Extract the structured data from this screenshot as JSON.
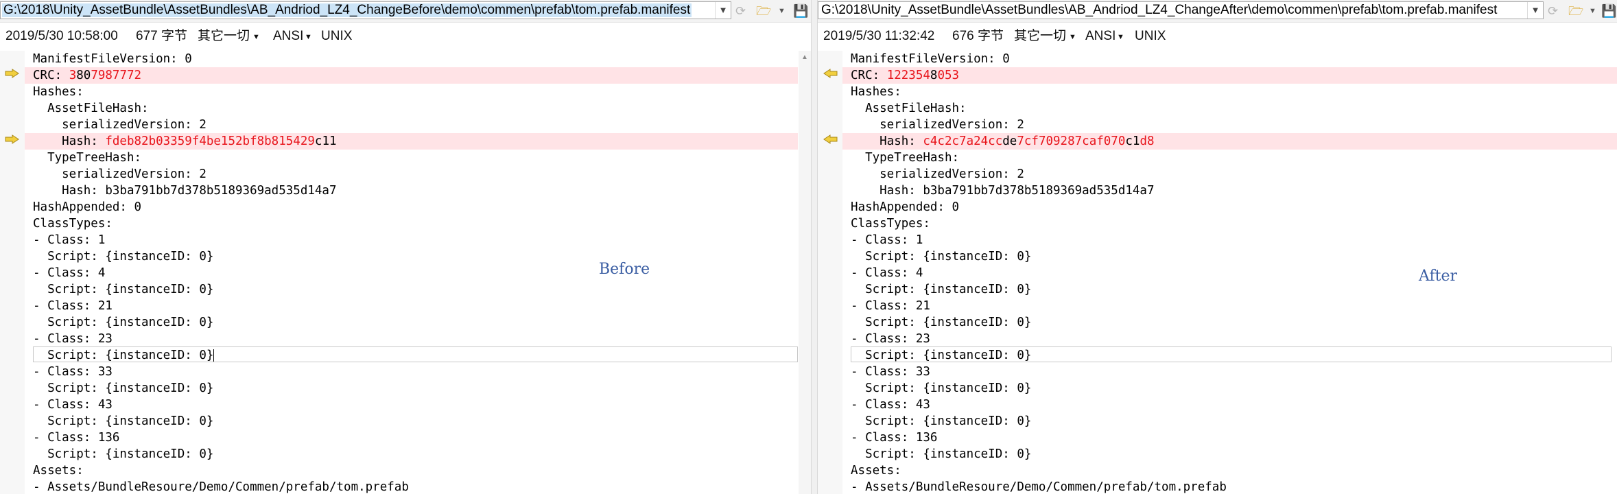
{
  "left": {
    "path": "G:\\2018\\Unity_AssetBundle\\AssetBundles\\AB_Andriod_LZ4_ChangeBefore\\demo\\commen\\prefab\\tom.prefab.manifest",
    "date": "2019/5/30 10:58:00",
    "size": "677 字节",
    "other": "其它一切",
    "encoding": "ANSI",
    "eol": "UNIX",
    "watermark": "Before",
    "crc_a": "3",
    "crc_b": "80",
    "crc_c": "7987772",
    "hash_a": "fde",
    "hash_b": "b82b03359f4be152bf8b815429",
    "hash_c": "c11"
  },
  "right": {
    "path": "G:\\2018\\Unity_AssetBundle\\AssetBundles\\AB_Andriod_LZ4_ChangeAfter\\demo\\commen\\prefab\\tom.prefab.manifest",
    "date": "2019/5/30 11:32:42",
    "size": "676 字节",
    "other": "其它一切",
    "encoding": "ANSI",
    "eol": "UNIX",
    "watermark": "After",
    "crc_a": "12235",
    "crc_b": "4",
    "crc_c": "8",
    "crc_d": "053",
    "hash_a": "c4c2c7a24cc",
    "hash_b": "de",
    "hash_c": "7cf709287caf070",
    "hash_d": "c1",
    "hash_e": "d8"
  },
  "lines": {
    "l01": "ManifestFileVersion: 0",
    "l02_prefix": "CRC: ",
    "l03": "Hashes:",
    "l04": "  AssetFileHash:",
    "l05": "    serializedVersion: 2",
    "l06_prefix": "    Hash: ",
    "l07": "  TypeTreeHash:",
    "l08": "    serializedVersion: 2",
    "l09": "    Hash: b3ba791bb7d378b5189369ad535d14a7",
    "l10": "HashAppended: 0",
    "l11": "ClassTypes:",
    "l12": "- Class: 1",
    "l13": "  Script: {instanceID: 0}",
    "l14": "- Class: 4",
    "l15": "  Script: {instanceID: 0}",
    "l16": "- Class: 21",
    "l17": "  Script: {instanceID: 0}",
    "l18": "- Class: 23",
    "l19": "  Script: {instanceID: 0}",
    "l20": "- Class: 33",
    "l21": "  Script: {instanceID: 0}",
    "l22": "- Class: 43",
    "l23": "  Script: {instanceID: 0}",
    "l24": "- Class: 136",
    "l25": "  Script: {instanceID: 0}",
    "l26": "Assets:",
    "l27": "- Assets/BundleResoure/Demo/Commen/prefab/tom.prefab"
  },
  "colors": {
    "diff_bg": "#ffe3e6",
    "diff_text": "#e8141b",
    "marker": "#e8c23a"
  },
  "icons": [
    "chevron-down-icon",
    "refresh-icon",
    "folder-open-icon",
    "save-icon",
    "diff-arrow-right-icon",
    "diff-arrow-left-icon"
  ]
}
